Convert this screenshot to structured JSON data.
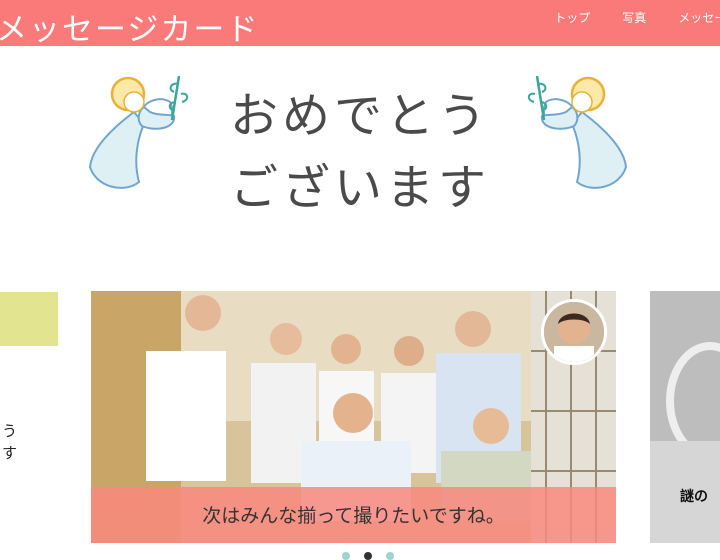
{
  "header": {
    "title": "メッセージカード",
    "nav": [
      {
        "label": "トップ"
      },
      {
        "label": "写真"
      },
      {
        "label": "メッセージ"
      }
    ],
    "bg_color": "#f97a78"
  },
  "hero": {
    "line1": "おめでとう",
    "line2": "ございます",
    "icon": "angel-icon"
  },
  "slides": {
    "left": {
      "text": "うす",
      "band_color": "#e2e48f"
    },
    "center": {
      "caption": "次はみんな揃って撮りたいですね。"
    },
    "right": {
      "text": "謎の"
    }
  },
  "pager": {
    "count": 3,
    "active": 1
  }
}
